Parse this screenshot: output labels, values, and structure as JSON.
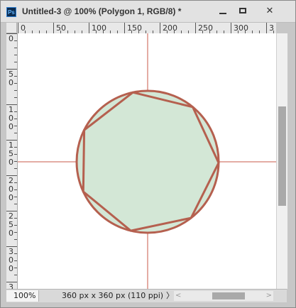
{
  "window": {
    "title": "Untitled-3 @ 100% (Polygon 1, RGB/8) *",
    "app_icon_label": "Ps",
    "app_icon": "photoshop-icon",
    "buttons": {
      "minimize": "minimize-icon",
      "maximize": "maximize-icon",
      "close_label": "✕"
    }
  },
  "rulers": {
    "top_labels": [
      "0",
      "50",
      "100",
      "150",
      "200",
      "250",
      "300",
      "3"
    ],
    "left_labels": [
      "0",
      "50",
      "100",
      "150",
      "200",
      "250",
      "300",
      "3"
    ]
  },
  "status": {
    "zoom": "100%",
    "doc_info": "360 px x 360 px (110 ppi)",
    "info_arrow": "〉",
    "scroll_left": "<",
    "scroll_right": ">"
  },
  "colors": {
    "shape_stroke": "#b5604f",
    "shape_fill": "#d3e7d6",
    "guide": "#c85a4a",
    "canvas": "#ffffff"
  },
  "shapes": {
    "circle": "ellipse",
    "polygon": "Polygon 1",
    "polygon_sides": 7
  }
}
